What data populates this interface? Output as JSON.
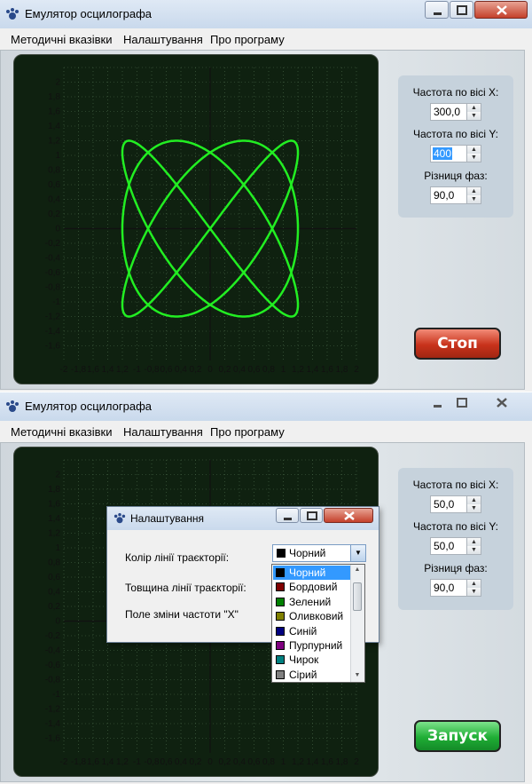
{
  "window_top": {
    "title": "Емулятор осцилографа",
    "menu": [
      "Методичні вказівки",
      "Налаштування",
      "Про програму"
    ],
    "controls": {
      "freq_x_label": "Частота по вісі X:",
      "freq_x_value": "300,0",
      "freq_y_label": "Частота по вісі Y:",
      "freq_y_value": "400",
      "phase_label": "Різниця фаз:",
      "phase_value": "90,0"
    },
    "action_button": "Стоп"
  },
  "window_bottom": {
    "title": "Емулятор осцилографа",
    "menu": [
      "Методичні вказівки",
      "Налаштування",
      "Про програму"
    ],
    "controls": {
      "freq_x_label": "Частота по вісі X:",
      "freq_x_value": "50,0",
      "freq_y_label": "Частота по вісі Y:",
      "freq_y_value": "50,0",
      "phase_label": "Різниця фаз:",
      "phase_value": "90,0"
    },
    "action_button": "Запуск"
  },
  "axis": {
    "x_ticks": [
      "-2",
      "-1,8",
      "1,6",
      "1,4",
      "1,2",
      "-1",
      "-0,8",
      "0,6",
      "0,4",
      "0,2",
      "0",
      "0,2",
      "0,4",
      "0,6",
      "0,8",
      "1",
      "1,2",
      "1,4",
      "1,6",
      "1,8",
      "2"
    ],
    "y_ticks": [
      "2",
      "1,8",
      "1,6",
      "1,4",
      "1,2",
      "1",
      "0,8",
      "0,6",
      "0,4",
      "0,2",
      "0",
      "-0,2",
      "-0,4",
      "-0,6",
      "-0,8",
      "-1",
      "-1,2",
      "-1,4",
      "-1,6"
    ]
  },
  "trace": {
    "color": "#22ee22",
    "freq_ratio": [
      3,
      4
    ],
    "phase_deg": 90,
    "amplitude": 1.2
  },
  "dialog": {
    "title": "Налаштування",
    "line_color_label": "Колір лінії траєкторії:",
    "line_width_label": "Товщина лінії траєкторії:",
    "freq_field_label": "Поле зміни частоти \"X\"",
    "selected_color": "Чорний",
    "color_options": [
      {
        "name": "Чорний",
        "hex": "#000000"
      },
      {
        "name": "Бордовий",
        "hex": "#800000"
      },
      {
        "name": "Зелений",
        "hex": "#008000"
      },
      {
        "name": "Оливковий",
        "hex": "#808000"
      },
      {
        "name": "Синій",
        "hex": "#000080"
      },
      {
        "name": "Пурпурний",
        "hex": "#800080"
      },
      {
        "name": "Чирок",
        "hex": "#008080"
      },
      {
        "name": "Сірий",
        "hex": "#808080"
      }
    ]
  },
  "colors": {
    "screen_bg": "#0f2110",
    "grid": "#4a6a4a",
    "stop_btn": "#c8321b",
    "start_btn": "#1fae35"
  }
}
